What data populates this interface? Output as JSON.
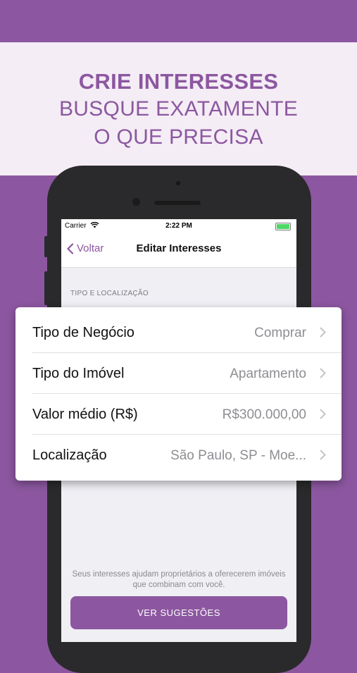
{
  "banner": {
    "headline": "CRIE INTERESSES",
    "line1": "BUSQUE EXATAMENTE",
    "line2": "O QUE PRECISA"
  },
  "status_bar": {
    "carrier": "Carrier",
    "time": "2:22 PM"
  },
  "nav": {
    "back_label": "Voltar",
    "title": "Editar Interesses"
  },
  "section_header": "TIPO E LOCALIZAÇÃO",
  "rows": [
    {
      "label": "Tipo de Negócio",
      "value": "Comprar"
    },
    {
      "label": "Tipo do Imóvel",
      "value": "Apartamento"
    },
    {
      "label": "Valor médio (R$)",
      "value": "R$300.000,00"
    },
    {
      "label": "Localização",
      "value": "São Paulo, SP - Moe..."
    }
  ],
  "footer_note": "Seus interesses ajudam proprietários a oferecerem imóveis que combinam com você.",
  "cta_label": "VER SUGESTÕES",
  "colors": {
    "brand_purple": "#8c57a0",
    "banner_bg": "#f4edf5",
    "phone_body": "#2a2a2c"
  }
}
